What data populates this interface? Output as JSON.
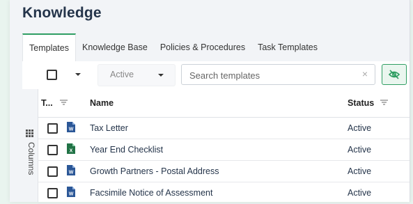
{
  "page": {
    "title": "Knowledge"
  },
  "tabs": [
    {
      "label": "Templates",
      "active": true
    },
    {
      "label": "Knowledge Base",
      "active": false
    },
    {
      "label": "Policies & Procedures",
      "active": false
    },
    {
      "label": "Task Templates",
      "active": false
    }
  ],
  "toolbar": {
    "status_filter": "Active",
    "search_placeholder": "Search templates",
    "search_value": "",
    "clear_symbol": "×",
    "visibility_icon": "eye-off-icon"
  },
  "columns_rail": {
    "label": "Columns",
    "icon": "grid-icon"
  },
  "table": {
    "headers": {
      "type": "T...",
      "name": "Name",
      "status": "Status"
    },
    "rows": [
      {
        "type": "word",
        "name": "Tax Letter",
        "status": "Active"
      },
      {
        "type": "excel",
        "name": "Year End Checklist",
        "status": "Active"
      },
      {
        "type": "word",
        "name": "Growth Partners - Postal Address",
        "status": "Active"
      },
      {
        "type": "word",
        "name": "Facsimile Notice of Assessment",
        "status": "Active"
      }
    ]
  },
  "colors": {
    "accent": "#2f9e63",
    "word": "#2b5797",
    "excel": "#217346",
    "text_dark": "#24344a"
  }
}
